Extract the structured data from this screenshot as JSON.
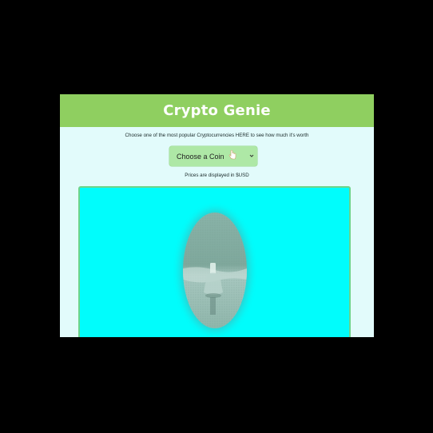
{
  "app": {
    "title": "Crypto Genie"
  },
  "intro": {
    "text": "Choose one of the most popular Cryptocurrencies HERE to see how much it's worth"
  },
  "coin_select": {
    "selected": "Choose a Coin",
    "pointer_icon": "hand-pointer-icon",
    "chevron_icon": "chevron-down-icon"
  },
  "currency_note": {
    "text": "Prices are displayed in $USD"
  },
  "display": {
    "image_icon": "genie-lamp-image"
  },
  "colors": {
    "header": "#8fcf60",
    "page": "#e2fbfb",
    "select": "#aee8a6",
    "display": "#00fdfc",
    "display_border": "#6fd48a"
  }
}
